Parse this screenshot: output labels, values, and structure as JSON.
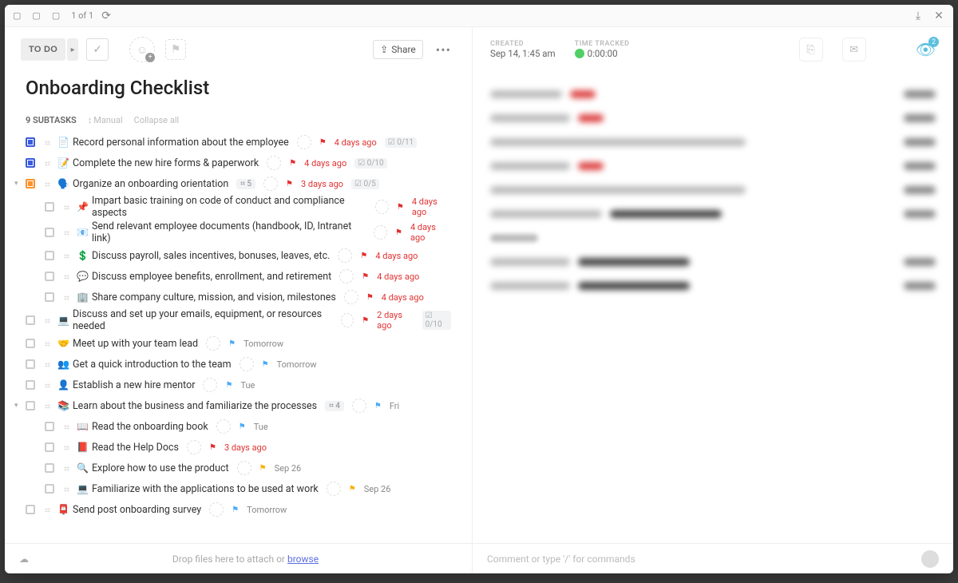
{
  "breadcrumbs": [
    "",
    "",
    ""
  ],
  "pager": "1 of 1",
  "header": {
    "status": "TO DO",
    "share": "Share"
  },
  "title": "Onboarding Checklist",
  "subtasks": {
    "count": "9 SUBTASKS",
    "sort": "Manual",
    "collapse": "Collapse all"
  },
  "right_meta": {
    "created_label": "CREATED",
    "created_value": "Sep 14, 1:45 am",
    "tracked_label": "TIME TRACKED",
    "tracked_value": "0:00:00",
    "watchers": "2"
  },
  "tasks": [
    {
      "level": 0,
      "status": "blue",
      "emoji": "📄",
      "title": "Record personal information about the employee",
      "flag": "red",
      "due": "4 days ago",
      "dueClass": "overdue",
      "ratio": "0/11"
    },
    {
      "level": 0,
      "status": "blue",
      "emoji": "📝",
      "title": "Complete the new hire forms & paperwork",
      "flag": "red",
      "due": "4 days ago",
      "dueClass": "overdue",
      "ratio": "0/10"
    },
    {
      "level": 0,
      "status": "orange",
      "expandable": true,
      "emoji": "🗣️",
      "title": "Organize an onboarding orientation",
      "subcount": "5",
      "flag": "red",
      "due": "3 days ago",
      "dueClass": "overdue",
      "ratio": "0/5"
    },
    {
      "level": 1,
      "status": "",
      "emoji": "📌",
      "title": "Impart basic training on code of conduct and compliance aspects",
      "flag": "red",
      "due": "4 days ago",
      "dueClass": "overdue"
    },
    {
      "level": 1,
      "status": "",
      "emoji": "📧",
      "title": "Send relevant employee documents (handbook, ID, Intranet link)",
      "flag": "red",
      "due": "4 days ago",
      "dueClass": "overdue"
    },
    {
      "level": 1,
      "status": "",
      "emoji": "💲",
      "title": "Discuss payroll, sales incentives, bonuses, leaves, etc.",
      "flag": "red",
      "due": "4 days ago",
      "dueClass": "overdue"
    },
    {
      "level": 1,
      "status": "",
      "emoji": "💬",
      "title": "Discuss employee benefits, enrollment, and retirement",
      "flag": "red",
      "due": "4 days ago",
      "dueClass": "overdue"
    },
    {
      "level": 1,
      "status": "",
      "emoji": "🏢",
      "title": "Share company culture, mission, and vision, milestones",
      "flag": "red",
      "due": "4 days ago",
      "dueClass": "overdue"
    },
    {
      "level": 0,
      "status": "",
      "emoji": "💻",
      "title": "Discuss and set up your emails, equipment, or resources needed",
      "flag": "red",
      "due": "2 days ago",
      "dueClass": "overdue",
      "ratio": "0/10"
    },
    {
      "level": 0,
      "status": "",
      "emoji": "🤝",
      "title": "Meet up with your team lead",
      "flag": "blue",
      "due": "Tomorrow",
      "dueClass": "gray"
    },
    {
      "level": 0,
      "status": "",
      "emoji": "👥",
      "title": "Get a quick introduction to the team",
      "flag": "blue",
      "due": "Tomorrow",
      "dueClass": "gray"
    },
    {
      "level": 0,
      "status": "",
      "emoji": "👤",
      "title": "Establish a new hire mentor",
      "flag": "blue",
      "due": "Tue",
      "dueClass": "gray"
    },
    {
      "level": 0,
      "status": "",
      "expandable": true,
      "emoji": "📚",
      "title": "Learn about the business and familiarize the processes",
      "subcount": "4",
      "flag": "blue",
      "due": "Fri",
      "dueClass": "gray"
    },
    {
      "level": 1,
      "status": "",
      "emoji": "📖",
      "title": "Read the onboarding book",
      "flag": "blue",
      "due": "Tue",
      "dueClass": "gray"
    },
    {
      "level": 1,
      "status": "",
      "emoji": "📕",
      "title": "Read the Help Docs",
      "flag": "red",
      "due": "3 days ago",
      "dueClass": "overdue"
    },
    {
      "level": 1,
      "status": "",
      "emoji": "🔍",
      "title": "Explore how to use the product",
      "flag": "yellow",
      "due": "Sep 26",
      "dueClass": "gray"
    },
    {
      "level": 1,
      "status": "",
      "emoji": "💻",
      "title": "Familiarize with the applications to be used at work",
      "flag": "yellow",
      "due": "Sep 26",
      "dueClass": "gray"
    },
    {
      "level": 0,
      "status": "",
      "emoji": "📮",
      "title": "Send post onboarding survey",
      "flag": "blue",
      "due": "Tomorrow",
      "dueClass": "gray"
    }
  ],
  "dropzone": {
    "text": "Drop files here to attach or ",
    "browse": "browse"
  },
  "comment": {
    "placeholder": "Comment or type '/' for commands"
  }
}
